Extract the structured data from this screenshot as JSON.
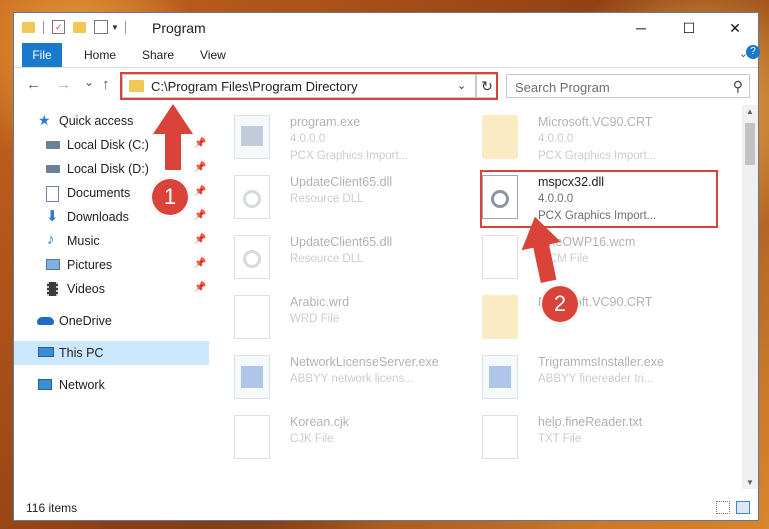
{
  "window": {
    "title": "Program",
    "minimize": "─",
    "maximize": "☐",
    "close": "✕"
  },
  "ribbon": {
    "tabs": [
      "File",
      "Home",
      "Share",
      "View"
    ]
  },
  "nav": {
    "back": "←",
    "forward": "→",
    "recent": "⌄",
    "up": "↑"
  },
  "address": {
    "path": "C:\\Program Files\\Program Directory",
    "refresh": "↻"
  },
  "search": {
    "placeholder": "Search Program"
  },
  "sidebar": {
    "items": [
      {
        "label": "Quick access",
        "icon": "star-icon"
      },
      {
        "label": "Local Disk (C:)",
        "icon": "drive-icon",
        "pinned": true
      },
      {
        "label": "Local Disk (D:)",
        "icon": "drive-icon",
        "pinned": true
      },
      {
        "label": "Documents",
        "icon": "documents-icon",
        "pinned": true
      },
      {
        "label": "Downloads",
        "icon": "downloads-icon",
        "pinned": true
      },
      {
        "label": "Music",
        "icon": "music-icon",
        "pinned": true
      },
      {
        "label": "Pictures",
        "icon": "pictures-icon",
        "pinned": true
      },
      {
        "label": "Videos",
        "icon": "videos-icon",
        "pinned": true
      },
      {
        "label": "OneDrive",
        "icon": "cloud-icon"
      },
      {
        "label": "This PC",
        "icon": "pc-icon",
        "selected": true
      },
      {
        "label": "Network",
        "icon": "network-icon"
      }
    ]
  },
  "files": [
    {
      "name": "program.exe",
      "version": "4.0.0.0",
      "desc": "PCX Graphics Import...",
      "icon": "exe-icon"
    },
    {
      "name": "Microsoft.VC90.CRT",
      "version": "4.0.0.0",
      "desc": "PCX Graphics Import...",
      "icon": "folder-icon"
    },
    {
      "name": "UpdateClient65.dll",
      "version": "",
      "desc": "Resource DLL",
      "icon": "dll-icon"
    },
    {
      "name": "mspcx32.dll",
      "version": "4.0.0.0",
      "desc": "PCX Graphics Import...",
      "icon": "dll-icon",
      "highlighted": true
    },
    {
      "name": "UpdateClient65.dll",
      "version": "",
      "desc": "Resource DLL",
      "icon": "dll-icon"
    },
    {
      "name": "FineOWP16.wcm",
      "version": "",
      "desc": "WCM File",
      "icon": "file-icon"
    },
    {
      "name": "Arabic.wrd",
      "version": "",
      "desc": "WRD File",
      "icon": "file-icon"
    },
    {
      "name": "Microsoft.VC90.CRT",
      "version": "",
      "desc": "",
      "icon": "folder-icon"
    },
    {
      "name": "NetworkLicenseServer.exe",
      "version": "",
      "desc": "ABBYY network licens...",
      "icon": "app-icon"
    },
    {
      "name": "TrigrammsInstaller.exe",
      "version": "",
      "desc": "ABBYY finereader tri...",
      "icon": "app-icon"
    },
    {
      "name": "Korean.cjk",
      "version": "",
      "desc": "CJK File",
      "icon": "file-icon"
    },
    {
      "name": "help.fineReader.txt",
      "version": "",
      "desc": "TXT File",
      "icon": "file-icon"
    }
  ],
  "status": {
    "count": "116 items"
  },
  "annotations": {
    "one": "1",
    "two": "2",
    "color": "#d9433a"
  }
}
